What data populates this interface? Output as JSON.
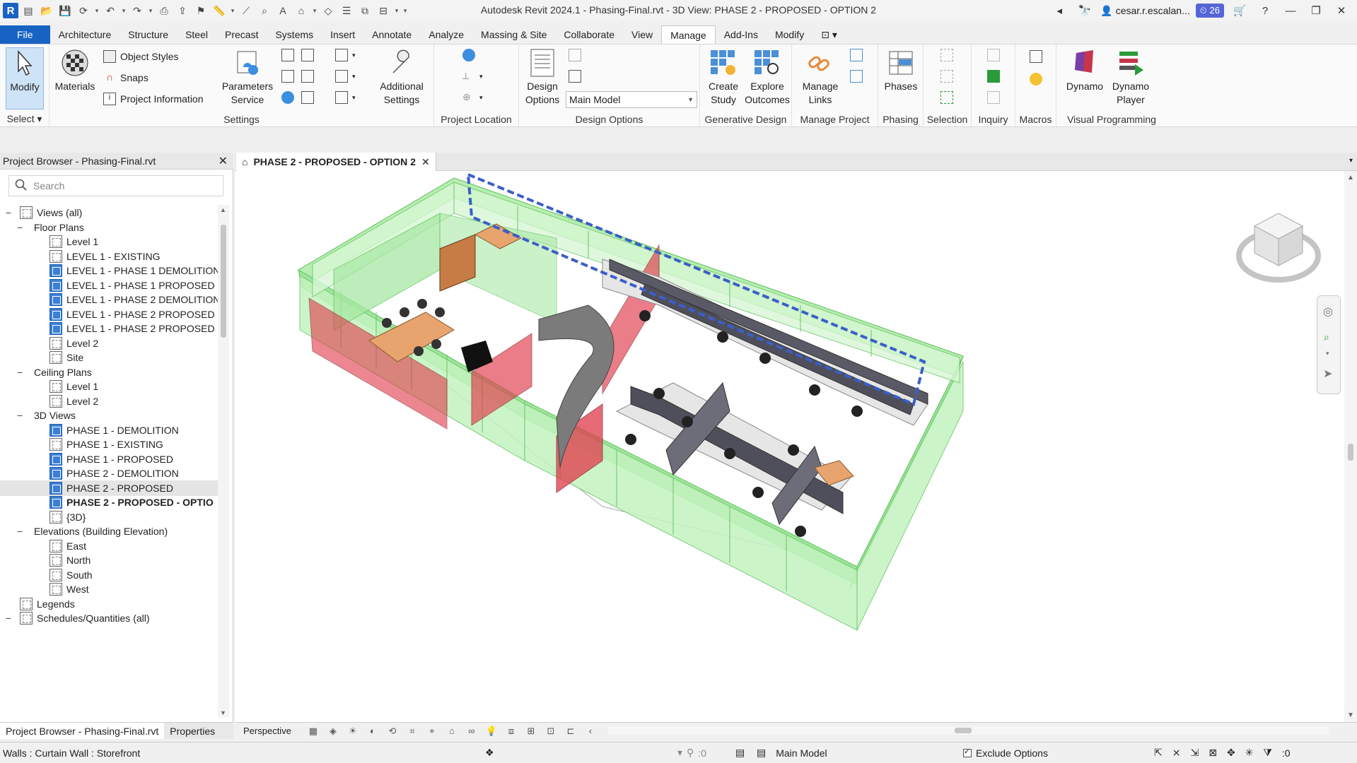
{
  "app": {
    "title": "Autodesk Revit 2024.1 - Phasing-Final.rvt - 3D View: PHASE 2 - PROPOSED - OPTION 2",
    "user": "cesar.r.escalan...",
    "notifications": "26"
  },
  "tabs": [
    "File",
    "Architecture",
    "Structure",
    "Steel",
    "Precast",
    "Systems",
    "Insert",
    "Annotate",
    "Analyze",
    "Massing & Site",
    "Collaborate",
    "View",
    "Manage",
    "Add-Ins",
    "Modify"
  ],
  "active_tab": "Manage",
  "ribbon": {
    "select": {
      "modify": "Modify",
      "label": "Select"
    },
    "settings": {
      "materials": "Materials",
      "object_styles": "Object  Styles",
      "snaps": "Snaps",
      "project_info": "Project  Information",
      "parameters_service_1": "Parameters",
      "parameters_service_2": "Service",
      "additional_1": "Additional",
      "additional_2": "Settings",
      "label": "Settings"
    },
    "project_location": {
      "label": "Project Location"
    },
    "design_options": {
      "btn1": "Design",
      "btn2": "Options",
      "dropdown": "Main Model",
      "label": "Design Options"
    },
    "generative": {
      "create1": "Create",
      "create2": "Study",
      "explore1": "Explore",
      "explore2": "Outcomes",
      "label": "Generative Design"
    },
    "manage_project": {
      "btn1": "Manage",
      "btn2": "Links",
      "label": "Manage Project"
    },
    "phasing": {
      "btn": "Phases",
      "label": "Phasing"
    },
    "selection": {
      "label": "Selection"
    },
    "inquiry": {
      "label": "Inquiry"
    },
    "macros": {
      "label": "Macros"
    },
    "visual": {
      "dynamo": "Dynamo",
      "player1": "Dynamo",
      "player2": "Player",
      "label": "Visual Programming"
    }
  },
  "browser": {
    "title": "Project Browser - Phasing-Final.rvt",
    "search_placeholder": "Search",
    "tree": [
      {
        "label": "Views (all)",
        "level": 0,
        "exp": "−",
        "icon": "views"
      },
      {
        "label": "Floor Plans",
        "level": 1,
        "exp": "−",
        "icon": ""
      },
      {
        "label": "Level 1",
        "level": 2,
        "exp": "",
        "icon": "off"
      },
      {
        "label": "LEVEL 1 - EXISTING",
        "level": 2,
        "exp": "",
        "icon": "off"
      },
      {
        "label": "LEVEL 1 - PHASE 1 DEMOLITION",
        "level": 2,
        "exp": "",
        "icon": "on"
      },
      {
        "label": "LEVEL 1 - PHASE 1 PROPOSED",
        "level": 2,
        "exp": "",
        "icon": "on"
      },
      {
        "label": "LEVEL 1 - PHASE 2 DEMOLITION",
        "level": 2,
        "exp": "",
        "icon": "on"
      },
      {
        "label": "LEVEL 1 - PHASE 2 PROPOSED",
        "level": 2,
        "exp": "",
        "icon": "on"
      },
      {
        "label": "LEVEL 1 - PHASE 2 PROPOSED -",
        "level": 2,
        "exp": "",
        "icon": "on"
      },
      {
        "label": "Level 2",
        "level": 2,
        "exp": "",
        "icon": "off"
      },
      {
        "label": "Site",
        "level": 2,
        "exp": "",
        "icon": "off"
      },
      {
        "label": "Ceiling Plans",
        "level": 1,
        "exp": "−",
        "icon": ""
      },
      {
        "label": "Level 1",
        "level": 2,
        "exp": "",
        "icon": "off"
      },
      {
        "label": "Level 2",
        "level": 2,
        "exp": "",
        "icon": "off"
      },
      {
        "label": "3D Views",
        "level": 1,
        "exp": "−",
        "icon": ""
      },
      {
        "label": "PHASE 1 - DEMOLITION",
        "level": 2,
        "exp": "",
        "icon": "on"
      },
      {
        "label": "PHASE 1 - EXISTING",
        "level": 2,
        "exp": "",
        "icon": "off"
      },
      {
        "label": "PHASE 1 - PROPOSED",
        "level": 2,
        "exp": "",
        "icon": "on"
      },
      {
        "label": "PHASE 2 - DEMOLITION",
        "level": 2,
        "exp": "",
        "icon": "on"
      },
      {
        "label": "PHASE 2 - PROPOSED",
        "level": 2,
        "exp": "",
        "icon": "on",
        "sel": true
      },
      {
        "label": "PHASE 2 - PROPOSED - OPTIO",
        "level": 2,
        "exp": "",
        "icon": "on",
        "bold": true
      },
      {
        "label": "{3D}",
        "level": 2,
        "exp": "",
        "icon": "off"
      },
      {
        "label": "Elevations (Building Elevation)",
        "level": 1,
        "exp": "−",
        "icon": ""
      },
      {
        "label": "East",
        "level": 2,
        "exp": "",
        "icon": "off"
      },
      {
        "label": "North",
        "level": 2,
        "exp": "",
        "icon": "off"
      },
      {
        "label": "South",
        "level": 2,
        "exp": "",
        "icon": "off"
      },
      {
        "label": "West",
        "level": 2,
        "exp": "",
        "icon": "off"
      },
      {
        "label": "Legends",
        "level": 0,
        "exp": "",
        "icon": "legend"
      },
      {
        "label": "Schedules/Quantities (all)",
        "level": 0,
        "exp": "−",
        "icon": "sched"
      }
    ]
  },
  "pane_tabs": [
    "Project Browser - Phasing-Final.rvt",
    "Properties"
  ],
  "view": {
    "tab_title": "PHASE 2 - PROPOSED - OPTION 2",
    "mode": "Perspective"
  },
  "status": {
    "left": "Walls : Curtain Wall : Storefront",
    "sel_count": ":0",
    "model": "Main Model",
    "exclude": "Exclude Options",
    "filter_count": ":0"
  },
  "colors": {
    "accent": "#1862c4",
    "glass": "#7ee07e",
    "red": "#e0394a"
  }
}
